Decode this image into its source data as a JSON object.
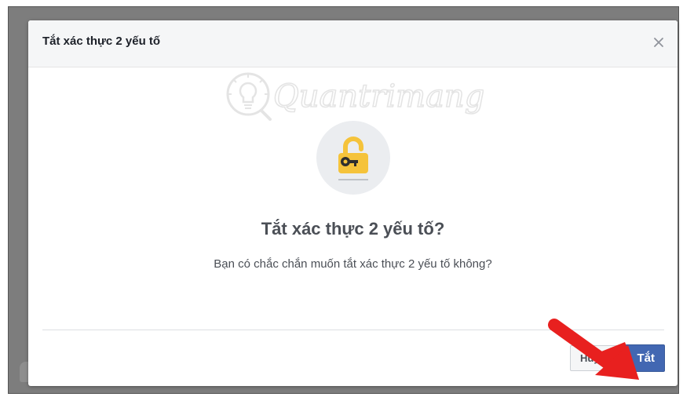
{
  "dialog": {
    "title": "Tắt xác thực 2 yếu tố",
    "close_icon": "close-icon",
    "heading": "Tắt xác thực 2 yếu tố?",
    "message": "Bạn có chắc chắn muốn tắt xác thực 2 yếu tố không?",
    "lock_icon": "lock-key-icon",
    "cancel_label": "Hủy",
    "confirm_label": "Tắt"
  },
  "watermark": {
    "text": "Quantrimang"
  },
  "colors": {
    "primary_button": "#4267b2",
    "lock": "#f5c33b",
    "arrow": "#e8201f",
    "overlay": "#7d7d7d"
  }
}
